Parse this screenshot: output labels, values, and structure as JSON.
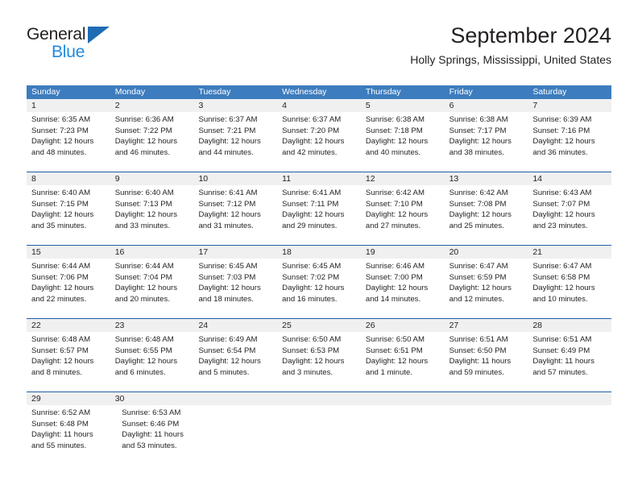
{
  "brand": {
    "name_top": "General",
    "name_bottom": "Blue",
    "accent_blue": "#1f8ae0",
    "triangle_blue": "#1f6cb4"
  },
  "header": {
    "title": "September 2024",
    "location": "Holly Springs, Mississippi, United States"
  },
  "calendar": {
    "header_bg": "#3d7cbe",
    "header_text": "#ffffff",
    "row_divider": "#1f5fa8",
    "daynum_bg": "#f0f0f0",
    "weekdays": [
      "Sunday",
      "Monday",
      "Tuesday",
      "Wednesday",
      "Thursday",
      "Friday",
      "Saturday"
    ],
    "weeks": [
      {
        "days": [
          {
            "num": "1",
            "sunrise": "Sunrise: 6:35 AM",
            "sunset": "Sunset: 7:23 PM",
            "daylight_1": "Daylight: 12 hours",
            "daylight_2": "and 48 minutes."
          },
          {
            "num": "2",
            "sunrise": "Sunrise: 6:36 AM",
            "sunset": "Sunset: 7:22 PM",
            "daylight_1": "Daylight: 12 hours",
            "daylight_2": "and 46 minutes."
          },
          {
            "num": "3",
            "sunrise": "Sunrise: 6:37 AM",
            "sunset": "Sunset: 7:21 PM",
            "daylight_1": "Daylight: 12 hours",
            "daylight_2": "and 44 minutes."
          },
          {
            "num": "4",
            "sunrise": "Sunrise: 6:37 AM",
            "sunset": "Sunset: 7:20 PM",
            "daylight_1": "Daylight: 12 hours",
            "daylight_2": "and 42 minutes."
          },
          {
            "num": "5",
            "sunrise": "Sunrise: 6:38 AM",
            "sunset": "Sunset: 7:18 PM",
            "daylight_1": "Daylight: 12 hours",
            "daylight_2": "and 40 minutes."
          },
          {
            "num": "6",
            "sunrise": "Sunrise: 6:38 AM",
            "sunset": "Sunset: 7:17 PM",
            "daylight_1": "Daylight: 12 hours",
            "daylight_2": "and 38 minutes."
          },
          {
            "num": "7",
            "sunrise": "Sunrise: 6:39 AM",
            "sunset": "Sunset: 7:16 PM",
            "daylight_1": "Daylight: 12 hours",
            "daylight_2": "and 36 minutes."
          }
        ]
      },
      {
        "days": [
          {
            "num": "8",
            "sunrise": "Sunrise: 6:40 AM",
            "sunset": "Sunset: 7:15 PM",
            "daylight_1": "Daylight: 12 hours",
            "daylight_2": "and 35 minutes."
          },
          {
            "num": "9",
            "sunrise": "Sunrise: 6:40 AM",
            "sunset": "Sunset: 7:13 PM",
            "daylight_1": "Daylight: 12 hours",
            "daylight_2": "and 33 minutes."
          },
          {
            "num": "10",
            "sunrise": "Sunrise: 6:41 AM",
            "sunset": "Sunset: 7:12 PM",
            "daylight_1": "Daylight: 12 hours",
            "daylight_2": "and 31 minutes."
          },
          {
            "num": "11",
            "sunrise": "Sunrise: 6:41 AM",
            "sunset": "Sunset: 7:11 PM",
            "daylight_1": "Daylight: 12 hours",
            "daylight_2": "and 29 minutes."
          },
          {
            "num": "12",
            "sunrise": "Sunrise: 6:42 AM",
            "sunset": "Sunset: 7:10 PM",
            "daylight_1": "Daylight: 12 hours",
            "daylight_2": "and 27 minutes."
          },
          {
            "num": "13",
            "sunrise": "Sunrise: 6:42 AM",
            "sunset": "Sunset: 7:08 PM",
            "daylight_1": "Daylight: 12 hours",
            "daylight_2": "and 25 minutes."
          },
          {
            "num": "14",
            "sunrise": "Sunrise: 6:43 AM",
            "sunset": "Sunset: 7:07 PM",
            "daylight_1": "Daylight: 12 hours",
            "daylight_2": "and 23 minutes."
          }
        ]
      },
      {
        "days": [
          {
            "num": "15",
            "sunrise": "Sunrise: 6:44 AM",
            "sunset": "Sunset: 7:06 PM",
            "daylight_1": "Daylight: 12 hours",
            "daylight_2": "and 22 minutes."
          },
          {
            "num": "16",
            "sunrise": "Sunrise: 6:44 AM",
            "sunset": "Sunset: 7:04 PM",
            "daylight_1": "Daylight: 12 hours",
            "daylight_2": "and 20 minutes."
          },
          {
            "num": "17",
            "sunrise": "Sunrise: 6:45 AM",
            "sunset": "Sunset: 7:03 PM",
            "daylight_1": "Daylight: 12 hours",
            "daylight_2": "and 18 minutes."
          },
          {
            "num": "18",
            "sunrise": "Sunrise: 6:45 AM",
            "sunset": "Sunset: 7:02 PM",
            "daylight_1": "Daylight: 12 hours",
            "daylight_2": "and 16 minutes."
          },
          {
            "num": "19",
            "sunrise": "Sunrise: 6:46 AM",
            "sunset": "Sunset: 7:00 PM",
            "daylight_1": "Daylight: 12 hours",
            "daylight_2": "and 14 minutes."
          },
          {
            "num": "20",
            "sunrise": "Sunrise: 6:47 AM",
            "sunset": "Sunset: 6:59 PM",
            "daylight_1": "Daylight: 12 hours",
            "daylight_2": "and 12 minutes."
          },
          {
            "num": "21",
            "sunrise": "Sunrise: 6:47 AM",
            "sunset": "Sunset: 6:58 PM",
            "daylight_1": "Daylight: 12 hours",
            "daylight_2": "and 10 minutes."
          }
        ]
      },
      {
        "days": [
          {
            "num": "22",
            "sunrise": "Sunrise: 6:48 AM",
            "sunset": "Sunset: 6:57 PM",
            "daylight_1": "Daylight: 12 hours",
            "daylight_2": "and 8 minutes."
          },
          {
            "num": "23",
            "sunrise": "Sunrise: 6:48 AM",
            "sunset": "Sunset: 6:55 PM",
            "daylight_1": "Daylight: 12 hours",
            "daylight_2": "and 6 minutes."
          },
          {
            "num": "24",
            "sunrise": "Sunrise: 6:49 AM",
            "sunset": "Sunset: 6:54 PM",
            "daylight_1": "Daylight: 12 hours",
            "daylight_2": "and 5 minutes."
          },
          {
            "num": "25",
            "sunrise": "Sunrise: 6:50 AM",
            "sunset": "Sunset: 6:53 PM",
            "daylight_1": "Daylight: 12 hours",
            "daylight_2": "and 3 minutes."
          },
          {
            "num": "26",
            "sunrise": "Sunrise: 6:50 AM",
            "sunset": "Sunset: 6:51 PM",
            "daylight_1": "Daylight: 12 hours",
            "daylight_2": "and 1 minute."
          },
          {
            "num": "27",
            "sunrise": "Sunrise: 6:51 AM",
            "sunset": "Sunset: 6:50 PM",
            "daylight_1": "Daylight: 11 hours",
            "daylight_2": "and 59 minutes."
          },
          {
            "num": "28",
            "sunrise": "Sunrise: 6:51 AM",
            "sunset": "Sunset: 6:49 PM",
            "daylight_1": "Daylight: 11 hours",
            "daylight_2": "and 57 minutes."
          }
        ]
      },
      {
        "days": [
          {
            "num": "29",
            "sunrise": "Sunrise: 6:52 AM",
            "sunset": "Sunset: 6:48 PM",
            "daylight_1": "Daylight: 11 hours",
            "daylight_2": "and 55 minutes."
          },
          {
            "num": "30",
            "sunrise": "Sunrise: 6:53 AM",
            "sunset": "Sunset: 6:46 PM",
            "daylight_1": "Daylight: 11 hours",
            "daylight_2": "and 53 minutes."
          },
          {
            "num": "",
            "sunrise": "",
            "sunset": "",
            "daylight_1": "",
            "daylight_2": ""
          },
          {
            "num": "",
            "sunrise": "",
            "sunset": "",
            "daylight_1": "",
            "daylight_2": ""
          },
          {
            "num": "",
            "sunrise": "",
            "sunset": "",
            "daylight_1": "",
            "daylight_2": ""
          },
          {
            "num": "",
            "sunrise": "",
            "sunset": "",
            "daylight_1": "",
            "daylight_2": ""
          },
          {
            "num": "",
            "sunrise": "",
            "sunset": "",
            "daylight_1": "",
            "daylight_2": ""
          }
        ]
      }
    ]
  }
}
